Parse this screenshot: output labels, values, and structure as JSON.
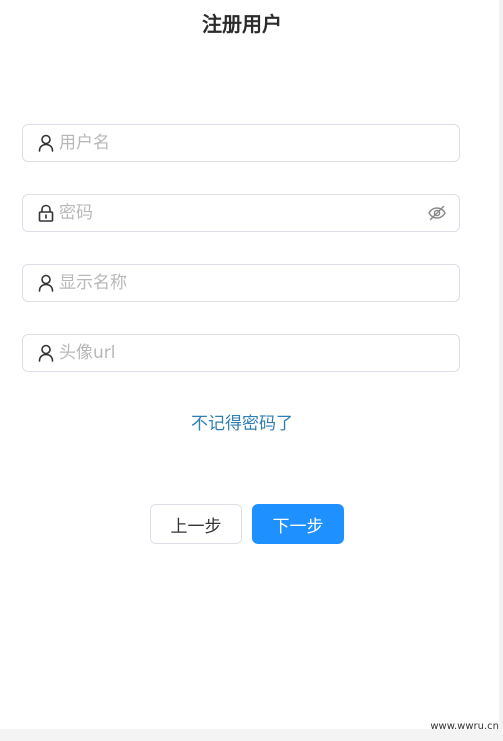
{
  "page": {
    "title": "注册用户"
  },
  "form": {
    "username_placeholder": "用户名",
    "password_placeholder": "密码",
    "display_name_placeholder": "显示名称",
    "avatar_url_placeholder": "头像url"
  },
  "links": {
    "forgot_password": "不记得密码了"
  },
  "buttons": {
    "prev_label": "上一步",
    "next_label": "下一步"
  },
  "watermark": "www.wwru.cn",
  "colors": {
    "primary": "#1e90ff",
    "link": "#2f7fb3",
    "border": "#dcdfe6",
    "placeholder": "#b8b8b8"
  },
  "icons": {
    "username": "user-icon",
    "password": "lock-icon",
    "password_toggle": "eye-hidden-icon",
    "display_name": "user-icon",
    "avatar_url": "user-icon"
  }
}
